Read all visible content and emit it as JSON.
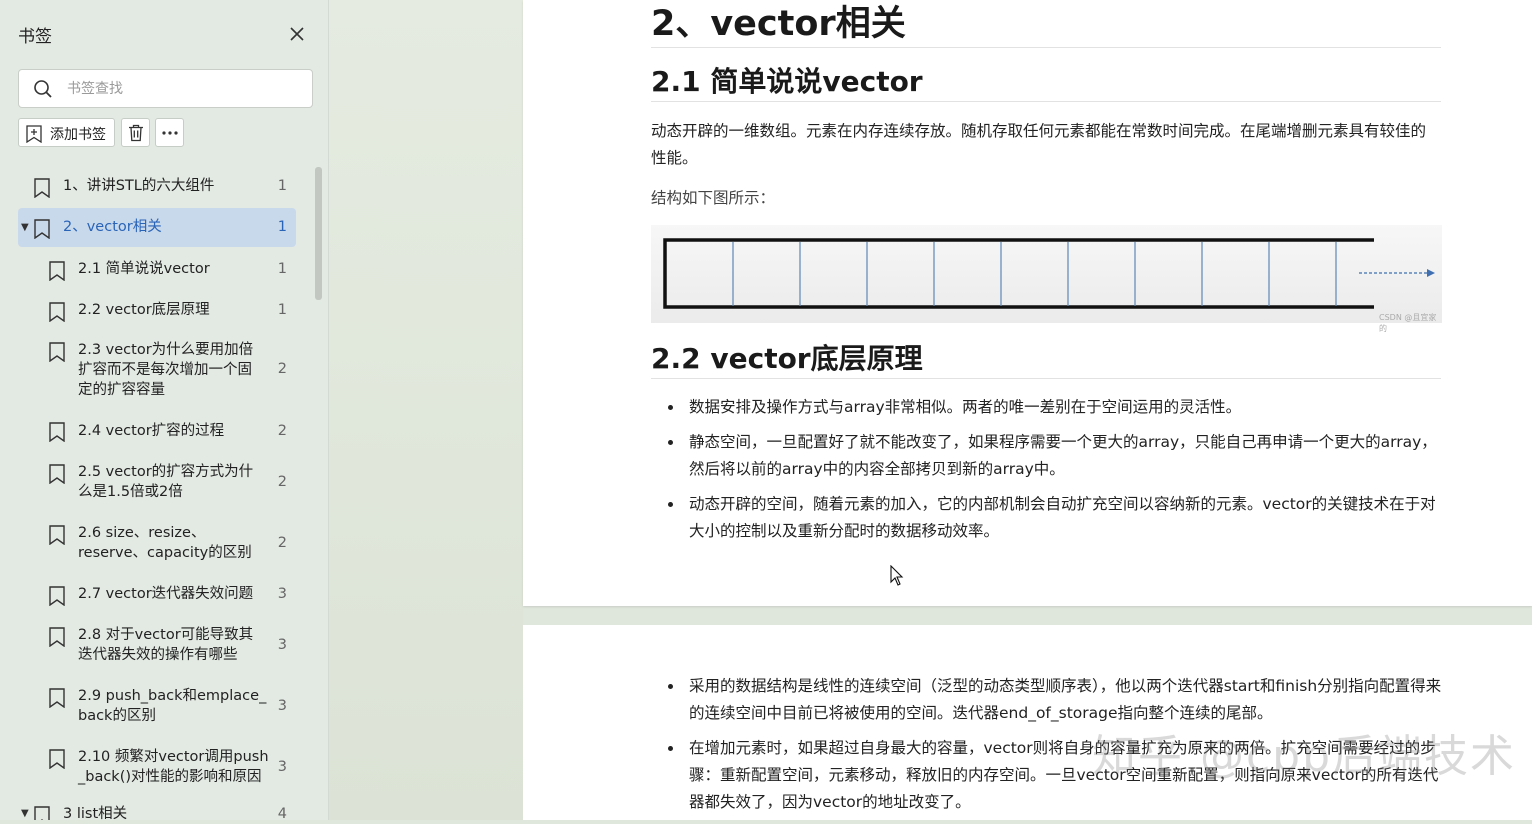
{
  "sidebar": {
    "title": "书签",
    "search_placeholder": "书签查找",
    "add_label": "添加书签",
    "bookmarks": [
      {
        "label": "1、讲讲STL的六大组件",
        "page": "1"
      },
      {
        "label": "2、vector相关",
        "page": "1"
      },
      {
        "label": "2.1 简单说说vector",
        "page": "1"
      },
      {
        "label": "2.2 vector底层原理",
        "page": "1"
      },
      {
        "label": "2.3 vector为什么要用加倍扩容而不是每次增加一个固定的扩容容量",
        "page": "2"
      },
      {
        "label": "2.4 vector扩容的过程",
        "page": "2"
      },
      {
        "label": "2.5 vector的扩容方式为什么是1.5倍或2倍",
        "page": "2"
      },
      {
        "label": "2.6 size、resize、reserve、capacity的区别",
        "page": "2"
      },
      {
        "label": "2.7 vector迭代器失效问题",
        "page": "3"
      },
      {
        "label": "2.8 对于vector可能导致其迭代器失效的操作有哪些",
        "page": "3"
      },
      {
        "label": "2.9 push_back和emplace_back的区别",
        "page": "3"
      },
      {
        "label": "2.10 频繁对vector调用push_back()对性能的影响和原因",
        "page": "3"
      },
      {
        "label": "3 list相关",
        "page": "4"
      }
    ]
  },
  "doc": {
    "heading_main": "2、vector相关",
    "heading_21": "2.1 简单说说vector",
    "para_21": "动态开辟的一维数组。元素在内存连续存放。随机存取任何元素都能在常数时间完成。在尾端增删元素具有较佳的性能。",
    "struct_caption": "结构如下图所示：",
    "diagram_credit": "CSDN @且宜家的",
    "heading_22": "2.2 vector底层原理",
    "bullets_22": [
      "数据安排及操作方式与array非常相似。两者的唯一差别在于空间运用的灵活性。",
      "静态空间，一旦配置好了就不能改变了，如果程序需要一个更大的array，只能自己再申请一个更大的array，然后将以前的array中的内容全部拷贝到新的array中。",
      "动态开辟的空间，随着元素的加入，它的内部机制会自动扩充空间以容纳新的元素。vector的关键技术在于对大小的控制以及重新分配时的数据移动效率。"
    ],
    "bullets_page2": [
      "采用的数据结构是线性的连续空间（泛型的动态类型顺序表），他以两个迭代器start和finish分别指向配置得来的连续空间中目前已将被使用的空间。迭代器end_of_storage指向整个连续的尾部。",
      "在增加元素时，如果超过自身最大的容量，vector则将自身的容量扩充为原来的两倍。扩充空间需要经过的步骤：重新配置空间，元素移动，释放旧的内存空间。一旦vector空间重新配置，则指向原来vector的所有迭代器都失效了，因为vector的地址改变了。"
    ]
  },
  "watermark": "知乎 @cpp后端技术",
  "colors": {
    "selected_bg": "#c9d9ec",
    "selected_text": "#2a64b7",
    "sidebar_bg": "#e3e9e3"
  }
}
